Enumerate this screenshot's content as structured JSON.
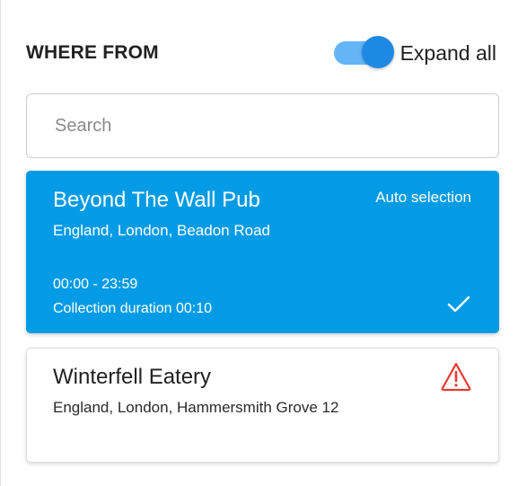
{
  "header": {
    "title": "WHERE FROM",
    "expand_all_label": "Expand all",
    "expand_all_on": true
  },
  "search": {
    "placeholder": "Search",
    "value": ""
  },
  "locations": [
    {
      "name": "Beyond The Wall Pub",
      "address": "England, London, Beadon Road",
      "badge": "Auto selection",
      "hours": "00:00 - 23:59",
      "duration": "Collection duration 00:10",
      "selected": true,
      "status_icon": "check-icon"
    },
    {
      "name": "Winterfell Eatery",
      "address": "England, London, Hammersmith Grove 12",
      "selected": false,
      "status_icon": "warning-icon"
    }
  ],
  "colors": {
    "selected_card": "#039be5",
    "toggle_track": "#64b5f6",
    "toggle_thumb": "#1e88e5",
    "warning": "#e53935"
  }
}
